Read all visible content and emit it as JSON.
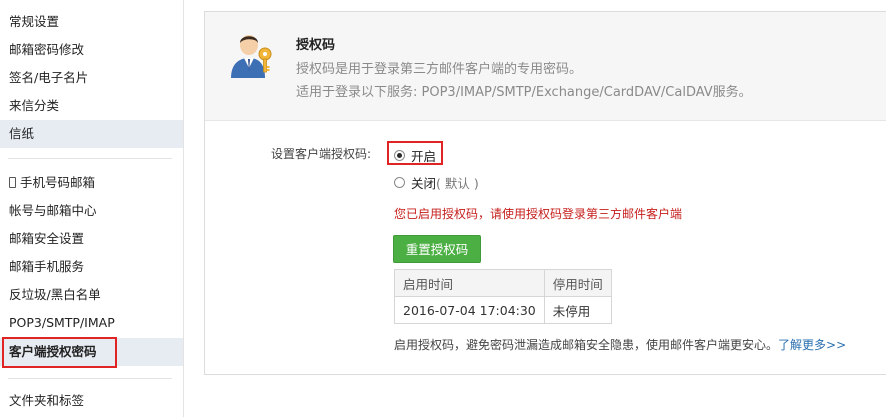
{
  "sidebar": {
    "items": [
      {
        "label": "常规设置"
      },
      {
        "label": "邮箱密码修改"
      },
      {
        "label": "签名/电子名片"
      },
      {
        "label": "来信分类"
      },
      {
        "label": "信纸"
      },
      {
        "label": "手机号码邮箱"
      },
      {
        "label": "帐号与邮箱中心"
      },
      {
        "label": "邮箱安全设置"
      },
      {
        "label": "邮箱手机服务"
      },
      {
        "label": "反垃圾/黑白名单"
      },
      {
        "label": "POP3/SMTP/IMAP"
      },
      {
        "label": "客户端授权密码"
      },
      {
        "label": "文件夹和标签"
      }
    ]
  },
  "header": {
    "title": "授权码",
    "desc1": "授权码是用于登录第三方邮件客户端的专用密码。",
    "desc2": "适用于登录以下服务: POP3/IMAP/SMTP/Exchange/CardDAV/CalDAV服务。"
  },
  "setting": {
    "label": "设置客户端授权码:",
    "option_on": "开启",
    "option_off": "关闭",
    "option_off_note": "( 默认 )",
    "selected": "开启"
  },
  "warning": "您已启用授权码，请使用授权码登录第三方邮件客户端",
  "reset_button": "重置授权码",
  "table": {
    "headers": [
      "启用时间",
      "停用时间"
    ],
    "rows": [
      [
        "2016-07-04 17:04:30",
        "未停用"
      ]
    ]
  },
  "footer": {
    "text": "启用授权码，避免密码泄漏造成邮箱安全隐患，使用邮件客户端更安心。",
    "link": "了解更多>>"
  },
  "colors": {
    "accent_green": "#4caf44",
    "warning_red": "#c6201d",
    "highlight_box": "#e02424",
    "link_blue": "#2a6fb0",
    "sidebar_active": "#e7ecf2"
  }
}
